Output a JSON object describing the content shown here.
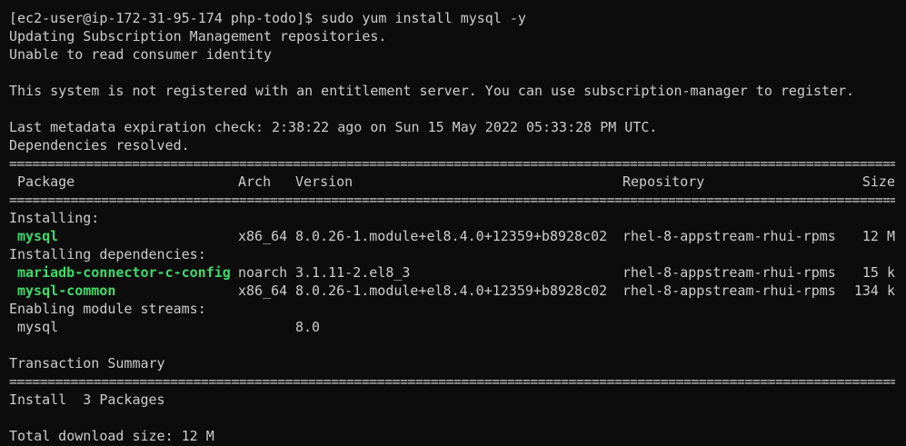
{
  "terminal": {
    "prompt_line": "[ec2-user@ip-172-31-95-174 php-todo]$ sudo yum install mysql -y",
    "msg1": "Updating Subscription Management repositories.",
    "msg2": "Unable to read consumer identity",
    "msg3": "This system is not registered with an entitlement server. You can use subscription-manager to register.",
    "msg4": "Last metadata expiration check: 2:38:22 ago on Sun 15 May 2022 05:33:28 PM UTC.",
    "msg5": "Dependencies resolved.",
    "rule": "==========================================================================================================================================================",
    "headers": {
      "package": "Package",
      "arch": "Arch",
      "version": "Version",
      "repository": "Repository",
      "size": "Size"
    },
    "section_installing": "Installing:",
    "section_deps": "Installing dependencies:",
    "section_modules": "Enabling module streams:",
    "packages_installing": [
      {
        "name": "mysql",
        "arch": "x86_64",
        "version": "8.0.26-1.module+el8.4.0+12359+b8928c02",
        "repo": "rhel-8-appstream-rhui-rpms",
        "size": "12 M"
      }
    ],
    "packages_deps": [
      {
        "name": "mariadb-connector-c-config",
        "arch": "noarch",
        "version": "3.1.11-2.el8_3",
        "repo": "rhel-8-appstream-rhui-rpms",
        "size": "15 k"
      },
      {
        "name": "mysql-common",
        "arch": "x86_64",
        "version": "8.0.26-1.module+el8.4.0+12359+b8928c02",
        "repo": "rhel-8-appstream-rhui-rpms",
        "size": "134 k"
      }
    ],
    "module_stream": {
      "name": "mysql",
      "version": "8.0"
    },
    "transaction_summary": "Transaction Summary",
    "install_summary": "Install  3 Packages",
    "total_download": "Total download size: 12 M",
    "colors": {
      "background": "#0c0c0c",
      "text": "#cccccc",
      "package_green": "#3fd96b"
    }
  }
}
